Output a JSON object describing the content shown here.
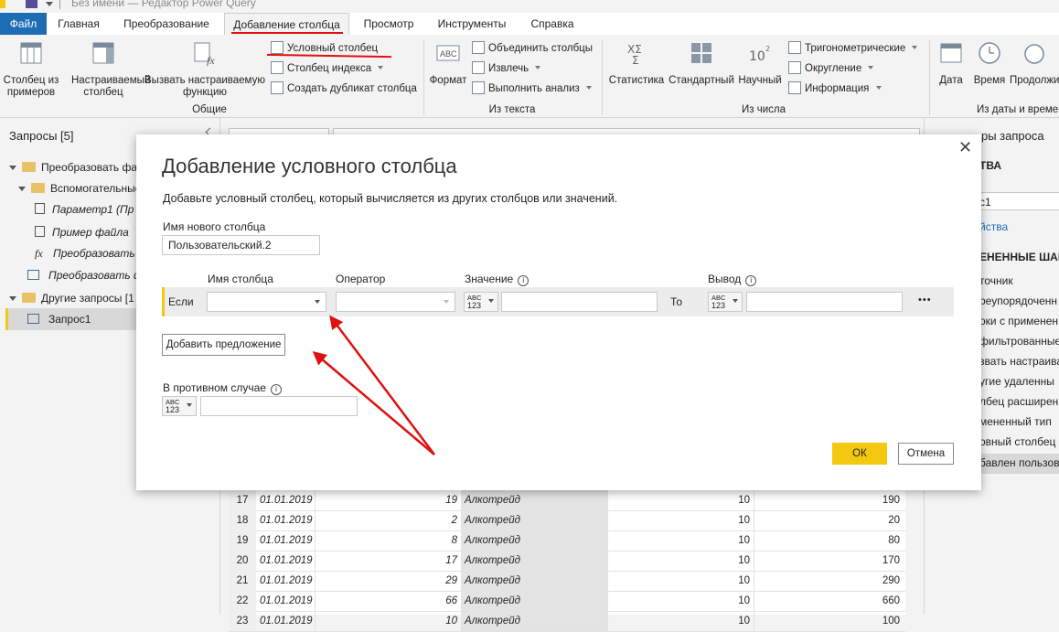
{
  "window": {
    "title": "Без имени — Редактор Power Query"
  },
  "menu": {
    "tabs": [
      "Файл",
      "Главная",
      "Преобразование",
      "Добавление столбца",
      "Просмотр",
      "Инструменты",
      "Справка"
    ]
  },
  "ribbon": {
    "general": {
      "col_from_examples": "Столбец из примеров",
      "custom_column": "Настраиваемый столбец",
      "invoke_function": "Вызвать настраиваемую функцию",
      "conditional_column": "Условный столбец",
      "index_column": "Столбец индекса",
      "duplicate_column": "Создать дубликат столбца",
      "group_label": "Общие"
    },
    "text": {
      "format": "Формат",
      "merge_columns": "Объединить столбцы",
      "extract": "Извлечь",
      "parse": "Выполнить анализ",
      "group_label": "Из текста"
    },
    "number": {
      "statistics": "Статистика",
      "standard": "Стандартный",
      "scientific": "Научный",
      "trig": "Тригонометрические",
      "rounding": "Округление",
      "information": "Информация",
      "group_label": "Из числа"
    },
    "datetime": {
      "date": "Дата",
      "time": "Время",
      "duration": "Продолжи",
      "group_label": "Из даты и времен"
    }
  },
  "left_panel": {
    "title": "Запросы [5]",
    "items": [
      {
        "label": "Преобразовать фа"
      },
      {
        "label": "Вспомогательные"
      },
      {
        "label": "Параметр1 (Пр"
      },
      {
        "label": "Пример файла"
      },
      {
        "label": "Преобразовать"
      },
      {
        "label": "Преобразовать ф"
      },
      {
        "label": "Другие запросы [1"
      },
      {
        "label": "Запрос1"
      }
    ]
  },
  "right_panel": {
    "title": "ры запроса",
    "section": "ТВА",
    "name_value": "с1",
    "all_props": "йства",
    "steps_title": "ЕНЕННЫЕ ШАГ",
    "steps": [
      "точник",
      "реупорядоченн",
      "оки с применен",
      "фильтрованные",
      "звать настраива",
      "угие удаленны",
      "лбец расширен",
      "мененный тип",
      "овный столбец",
      "бавлен пользов"
    ]
  },
  "dialog": {
    "title": "Добавление условного столбца",
    "description": "Добавьте условный столбец, который вычисляется из других столбцов или значений.",
    "new_column_label": "Имя нового столбца",
    "new_column_value": "Пользовательский.2",
    "headers": {
      "column": "Имя столбца",
      "operator": "Оператор",
      "value": "Значение",
      "output": "Вывод"
    },
    "if_label": "Если",
    "then_label": "То",
    "type_badge_top": "ABC",
    "type_badge_bottom": "123",
    "more": "•••",
    "add_clause": "Добавить предложение",
    "else_label": "В противном случае",
    "ok": "ОК",
    "cancel": "Отмена",
    "info_glyph": "i"
  },
  "table": {
    "rows": [
      {
        "n": "17",
        "date": "01.01.2019",
        "qty": "19",
        "name": "Алкотрейд",
        "x": "10",
        "total": "190"
      },
      {
        "n": "18",
        "date": "01.01.2019",
        "qty": "2",
        "name": "Алкотрейд",
        "x": "10",
        "total": "20"
      },
      {
        "n": "19",
        "date": "01.01.2019",
        "qty": "8",
        "name": "Алкотрейд",
        "x": "10",
        "total": "80"
      },
      {
        "n": "20",
        "date": "01.01.2019",
        "qty": "17",
        "name": "Алкотрейд",
        "x": "10",
        "total": "170"
      },
      {
        "n": "21",
        "date": "01.01.2019",
        "qty": "29",
        "name": "Алкотрейд",
        "x": "10",
        "total": "290"
      },
      {
        "n": "22",
        "date": "01.01.2019",
        "qty": "66",
        "name": "Алкотрейд",
        "x": "10",
        "total": "660"
      },
      {
        "n": "23",
        "date": "01.01.2019",
        "qty": "10",
        "name": "Алкотрейд",
        "x": "10",
        "total": "100"
      }
    ]
  },
  "colors": {
    "accent_blue": "#1e6cb3",
    "ok_yellow": "#f2c811",
    "annotation_red": "#e01010"
  }
}
